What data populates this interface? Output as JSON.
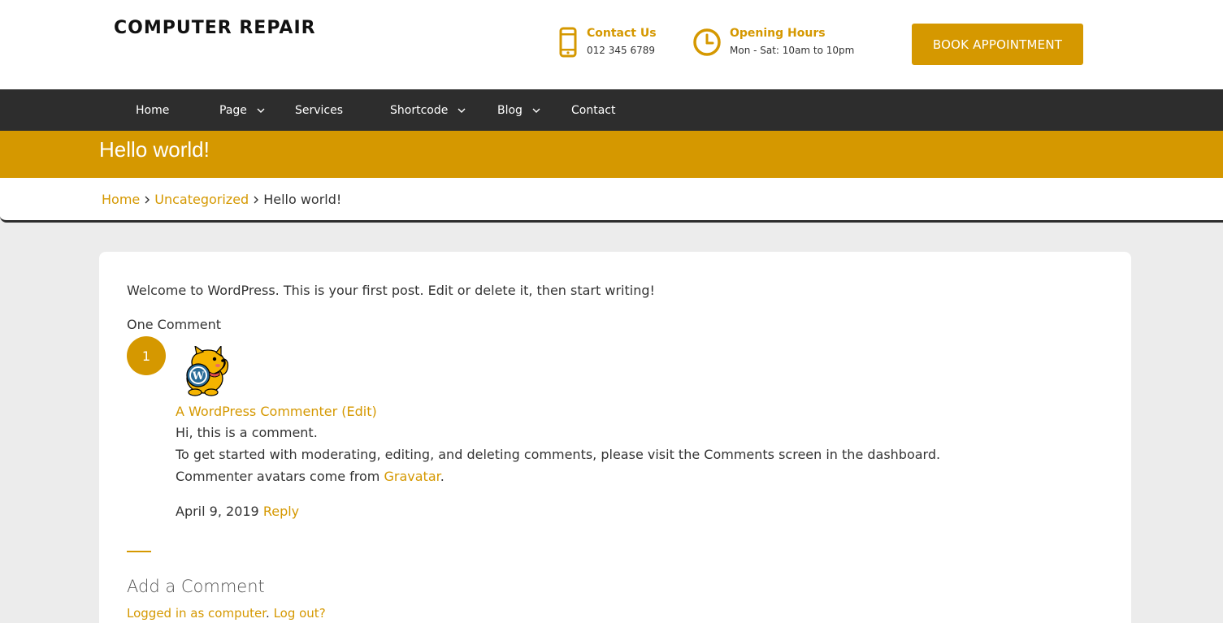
{
  "header": {
    "site_title": "COMPUTER REPAIR",
    "contact": {
      "title": "Contact Us",
      "value": "012 345 6789",
      "icon": "phone-icon"
    },
    "hours": {
      "title": "Opening Hours",
      "value": "Mon - Sat: 10am to 10pm",
      "icon": "clock-icon"
    },
    "book_button": "BOOK APPOINTMENT"
  },
  "nav": {
    "items": [
      {
        "label": "Home",
        "has_dropdown": false
      },
      {
        "label": "Page",
        "has_dropdown": true
      },
      {
        "label": "Services",
        "has_dropdown": false
      },
      {
        "label": "Shortcode",
        "has_dropdown": true
      },
      {
        "label": "Blog",
        "has_dropdown": true
      },
      {
        "label": "Contact",
        "has_dropdown": false
      }
    ]
  },
  "page_title": "Hello world!",
  "breadcrumb": {
    "items": [
      "Home",
      "Uncategorized"
    ],
    "current": "Hello world!"
  },
  "post": {
    "text": "Welcome to WordPress. This is your first post. Edit or delete it, then start writing!"
  },
  "comments": {
    "title": "One Comment",
    "number": "1",
    "author": "A WordPress Commenter",
    "edit_link": "(Edit)",
    "lines": [
      "Hi, this is a comment.",
      "To get started with moderating, editing, and deleting comments, please visit the Comments screen in the dashboard."
    ],
    "avatar_line_prefix": "Commenter avatars come from ",
    "avatar_line_link": "Gravatar",
    "avatar_line_suffix": ".",
    "date": "April 9, 2019",
    "reply": "Reply"
  },
  "comment_form": {
    "title": "Add a Comment",
    "logged_in_prefix": "Logged in as computer",
    "logged_in_sep": ". ",
    "logout": "Log out?"
  },
  "colors": {
    "accent": "#d59800",
    "nav_bg": "#2d2d2d",
    "page_bg": "#ececec"
  }
}
